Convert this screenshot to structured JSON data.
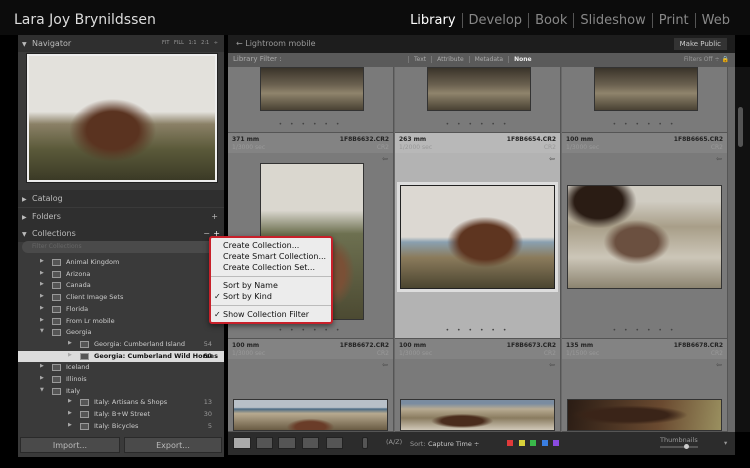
{
  "identity": "Lara Joy Brynildssen",
  "modules": [
    "Library",
    "Develop",
    "Book",
    "Slideshow",
    "Print",
    "Web"
  ],
  "navigator": {
    "title": "Navigator",
    "options": "FIT  FILL  1:1  2:1 ÷"
  },
  "panels": {
    "catalog": "Catalog",
    "folders": "Folders",
    "collections": "Collections"
  },
  "collection_filter_placeholder": "Filter Collections",
  "collections": [
    {
      "name": "Animal Kingdom",
      "level": 0,
      "open": false
    },
    {
      "name": "Arizona",
      "level": 0,
      "open": false
    },
    {
      "name": "Canada",
      "level": 0,
      "open": false
    },
    {
      "name": "Client Image Sets",
      "level": 0,
      "open": false
    },
    {
      "name": "Florida",
      "level": 0,
      "open": false
    },
    {
      "name": "From Lr mobile",
      "level": 0,
      "open": false
    },
    {
      "name": "Georgia",
      "level": 0,
      "open": true
    },
    {
      "name": "Georgia: Cumberland Island",
      "level": 1,
      "count": "54"
    },
    {
      "name": "Georgia: Cumberland Wild Horses",
      "level": 1,
      "count": "60",
      "selected": true
    },
    {
      "name": "Iceland",
      "level": 0,
      "open": false
    },
    {
      "name": "Illinois",
      "level": 0,
      "open": false
    },
    {
      "name": "Italy",
      "level": 0,
      "open": true
    },
    {
      "name": "Italy: Artisans & Shops",
      "level": 1,
      "count": "13"
    },
    {
      "name": "Italy: B+W Street",
      "level": 1,
      "count": "30"
    },
    {
      "name": "Italy: Bicycles",
      "level": 1,
      "count": "5"
    }
  ],
  "import_label": "Import...",
  "export_label": "Export...",
  "source": "Lightroom mobile",
  "make_public": "Make Public",
  "library_filter": {
    "label": "Library Filter :",
    "options": [
      "Text",
      "Attribute",
      "Metadata",
      "None"
    ],
    "filters_off": "Filters Off ÷"
  },
  "cells": [
    {
      "focal": "371 mm",
      "file": "1F8B6632.CR2",
      "shutter": "1/3000 sec",
      "ext": "CR2"
    },
    {
      "focal": "263 mm",
      "file": "1F8B6654.CR2",
      "shutter": "1/2000 sec",
      "ext": "CR2"
    },
    {
      "focal": "100 mm",
      "file": "1F8B6665.CR2",
      "shutter": "1/3000 sec",
      "ext": "CR2"
    },
    {
      "focal": "100 mm",
      "file": "1F8B6672.CR2",
      "shutter": "1/3000 sec",
      "ext": "CR2"
    },
    {
      "focal": "100 mm",
      "file": "1F8B6673.CR2",
      "shutter": "1/3000 sec",
      "ext": "CR2"
    },
    {
      "focal": "135 mm",
      "file": "1F8B6678.CR2",
      "shutter": "1/1500 sec",
      "ext": "CR2"
    }
  ],
  "toolbar": {
    "sort_label": "Sort:",
    "sort_value": "Capture Time ÷",
    "thumbnails": "Thumbnails",
    "colors": [
      "#e03a3a",
      "#d8d23a",
      "#3ab84a",
      "#3a7ee0",
      "#8a4ae0"
    ]
  },
  "menu": {
    "items": [
      "Create Collection...",
      "Create Smart Collection...",
      "Create Collection Set...",
      "Sort by Name",
      "Sort by Kind",
      "Show Collection Filter"
    ],
    "check": "✓"
  }
}
